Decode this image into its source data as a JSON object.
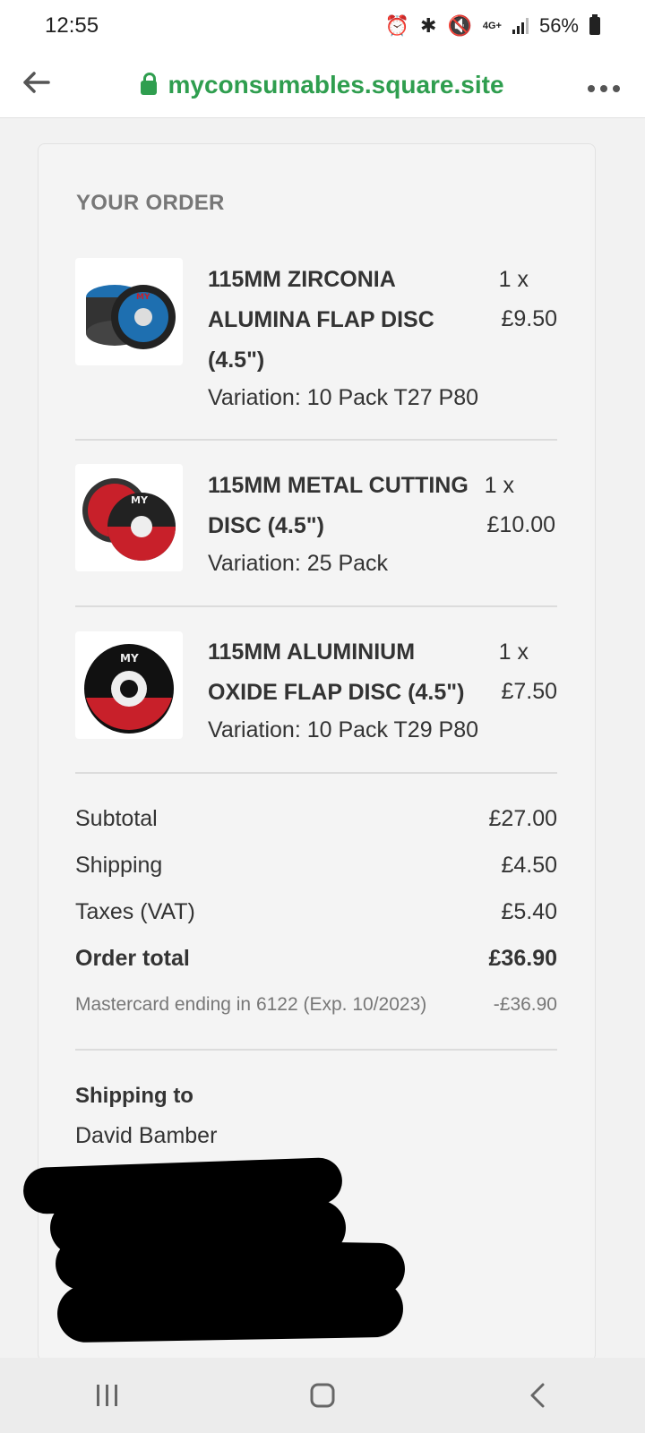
{
  "status_bar": {
    "time": "12:55",
    "network": "4G+",
    "battery": "56%"
  },
  "browser": {
    "url": "myconsumables.square.site"
  },
  "order": {
    "title": "YOUR ORDER",
    "items": [
      {
        "name_lines": [
          "115MM ZIRCONIA",
          "ALUMINA FLAP DISC",
          "(4.5\")"
        ],
        "variation": "Variation: 10 Pack T27 P80",
        "qty": "1 x",
        "price": "£9.50"
      },
      {
        "name_lines": [
          "115MM METAL CUTTING",
          "DISC (4.5\")"
        ],
        "variation": "Variation: 25 Pack",
        "qty": "1 x",
        "price": "£10.00"
      },
      {
        "name_lines": [
          "115MM ALUMINIUM",
          "OXIDE FLAP DISC (4.5\")"
        ],
        "variation": "Variation: 10 Pack T29 P80",
        "qty": "1 x",
        "price": "£7.50"
      }
    ],
    "totals": {
      "subtotal_label": "Subtotal",
      "subtotal_value": "£27.00",
      "shipping_label": "Shipping",
      "shipping_value": "£4.50",
      "taxes_label": "Taxes (VAT)",
      "taxes_value": "£5.40",
      "total_label": "Order total",
      "total_value": "£36.90"
    },
    "payment": {
      "label": "Mastercard ending in 6122 (Exp. 10/2023)",
      "value": "-£36.90"
    },
    "shipping_to": {
      "label": "Shipping to",
      "name": "David Bamber"
    }
  },
  "colors": {
    "accent_green": "#2f9e4f",
    "disc_blue": "#1e6fb0",
    "disc_red": "#c8202a"
  }
}
